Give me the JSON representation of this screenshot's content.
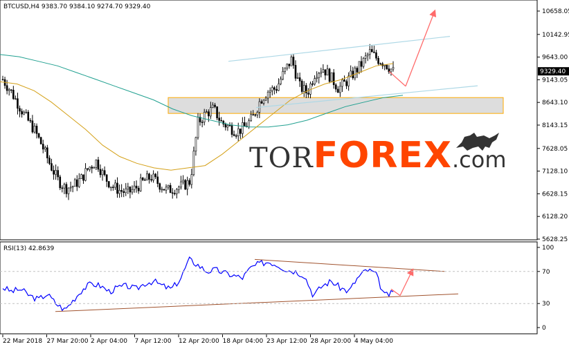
{
  "chart_data": [
    {
      "type": "candlestick",
      "symbol_line": "BTCUSD,H4  9383.70 9384.10 9274.70 9329.40",
      "current_price_label": "9329.40",
      "y_ticks": [
        "10658.05",
        "10142.95",
        "9643.00",
        "9143.05",
        "8643.10",
        "8143.15",
        "7628.05",
        "7128.10",
        "6628.15",
        "6128.20",
        "5628.25"
      ],
      "ylim": [
        5628.25,
        10658.05
      ],
      "x_ticks": [
        "22 Mar 2018",
        "27 Mar 20:00",
        "2 Apr 04:00",
        "7 Apr 12:00",
        "12 Apr 20:00",
        "18 Apr 04:00",
        "23 Apr 12:00",
        "28 Apr 20:00",
        "4 May 04:00"
      ],
      "close_path": [
        9150,
        8900,
        8600,
        8300,
        8050,
        7700,
        7300,
        6950,
        6750,
        6800,
        6950,
        7200,
        7350,
        7000,
        6800,
        6700,
        6650,
        6750,
        6900,
        7000,
        6850,
        6700,
        6750,
        6800,
        6900,
        8200,
        8400,
        8500,
        8200,
        8100,
        8000,
        8100,
        8300,
        8700,
        8900,
        8950,
        9300,
        9600,
        9000,
        8850,
        9300,
        9400,
        9200,
        8950,
        9100,
        9300,
        9500,
        9750,
        9600,
        9500,
        9329.4
      ],
      "ma_slow": [
        9700,
        9650,
        9550,
        9450,
        9300,
        9150,
        9000,
        8850,
        8700,
        8500,
        8350,
        8250,
        8150,
        8100,
        8100,
        8150,
        8250,
        8400,
        8550,
        8650,
        8750,
        8800
      ],
      "ma_fast": [
        9100,
        9050,
        8900,
        8650,
        8350,
        8050,
        7700,
        7450,
        7300,
        7200,
        7150,
        7200,
        7250,
        7500,
        7800,
        8100,
        8400,
        8700,
        8900,
        9050,
        9150,
        9300,
        9450,
        9500
      ],
      "currency_band": [
        8750,
        8400
      ],
      "trend_channel_upper": [
        9550,
        10100
      ],
      "trend_channel_lower": [
        8530,
        9010
      ],
      "forecast_arrow": [
        [
          9329.4,
          9000
        ],
        [
          9000,
          10658
        ]
      ]
    },
    {
      "type": "line",
      "label": "RSI(13) 42.8639",
      "y_ticks": [
        "100",
        "70",
        "30",
        "0"
      ],
      "ylim": [
        0,
        100
      ],
      "values": [
        50,
        45,
        48,
        40,
        35,
        42,
        30,
        22,
        35,
        48,
        55,
        52,
        45,
        50,
        52,
        48,
        55,
        58,
        52,
        48,
        60,
        85,
        78,
        70,
        72,
        68,
        65,
        62,
        75,
        80,
        82,
        78,
        72,
        70,
        65,
        40,
        52,
        58,
        50,
        45,
        62,
        72,
        68,
        40,
        42.86
      ],
      "support_line": [
        20,
        42
      ],
      "resistance_line": [
        85,
        70
      ]
    }
  ],
  "watermark": {
    "part1": "TOR",
    "part2": "FOREX",
    "part3": ".com",
    "accent": "#ff4500",
    "dark": "#333333"
  },
  "colors": {
    "candle": "#000000",
    "ma_fast": "#d4a017",
    "ma_slow": "#20a090",
    "rsi": "#0000ff",
    "arrow": "#ff6b6b",
    "trendline": "#a0522d",
    "channel": "#add8e6",
    "band_fill": "#dddddd",
    "band_stroke": "#ffaa00"
  }
}
